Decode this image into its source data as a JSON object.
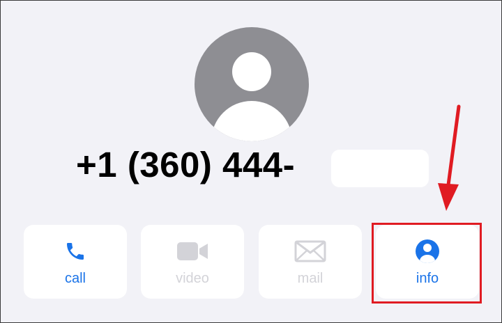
{
  "contact": {
    "phone_number": "+1 (360) 444-"
  },
  "actions": [
    {
      "id": "call",
      "label": "call",
      "icon": "phone-icon",
      "enabled": true
    },
    {
      "id": "video",
      "label": "video",
      "icon": "video-camera-icon",
      "enabled": false
    },
    {
      "id": "mail",
      "label": "mail",
      "icon": "envelope-icon",
      "enabled": false
    },
    {
      "id": "info",
      "label": "info",
      "icon": "person-circle-icon",
      "enabled": true
    }
  ],
  "annotation": {
    "color": "#e01b22",
    "target": "info"
  },
  "colors": {
    "accent": "#1a73e8",
    "disabled": "#d3d3d8",
    "background": "#f2f2f7",
    "avatar": "#8e8e93"
  }
}
